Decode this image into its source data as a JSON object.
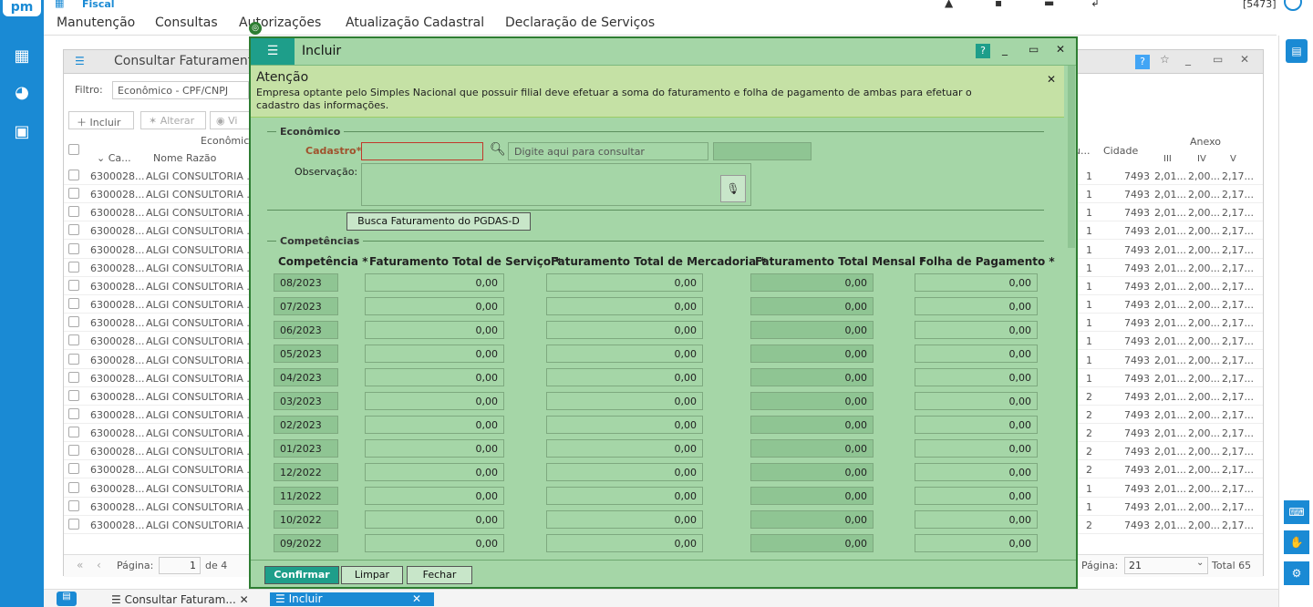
{
  "app": {
    "logo": "pm",
    "module": "Fiscal",
    "user_code": "[5473]"
  },
  "menu": [
    "Manutenção",
    "Consultas",
    "Autorizações",
    "Atualização Cadastral",
    "Declaração de Serviços"
  ],
  "bg": {
    "title": "Consultar Faturamento",
    "filter_label": "Filtro:",
    "filter_value": "Econômico - CPF/CNPJ",
    "btn_include": "Incluir",
    "btn_alter": "Alterar",
    "btn_view": "Vi",
    "group_header": "Econômico",
    "col_ca": "Ca...",
    "col_name": "Nome Razão",
    "col_cidade": "Cidade",
    "col_anexo": "Anexo",
    "col_iii": "III",
    "col_iv": "IV",
    "col_v": "V",
    "col_u": "u...",
    "row_code": "6300028...",
    "row_name": "ALGI CONSULTORIA ...",
    "row_city": "7493",
    "row_c1": "2,01...",
    "row_c2": "2,00...",
    "row_c3": "2,17...",
    "row_flags": [
      "1",
      "1",
      "1",
      "1",
      "1",
      "1",
      "1",
      "1",
      "1",
      "1",
      "1",
      "1",
      "2",
      "2",
      "2",
      "2",
      "2",
      "1",
      "1",
      "2"
    ],
    "pag_label": "Página:",
    "pag_value": "1",
    "pag_of": "de 4",
    "pag_right_label": "Página:",
    "pag_right_value": "21",
    "total": "Total 65"
  },
  "modal": {
    "title": "Incluir",
    "alert_title": "Atenção",
    "alert_text": "Empresa optante pelo Simples Nacional que possuir filial deve efetuar a soma do faturamento e folha de pagamento de ambas para efetuar o cadastro das informações.",
    "sec_economico": "Econômico",
    "cadastro_label": "Cadastro*",
    "cadastro_placeholder": "Digite aqui para consultar",
    "obs_label": "Observação:",
    "busca_btn": "Busca Faturamento do PGDAS-D",
    "sec_competencias": "Competências",
    "headers": [
      "Competência *",
      "Faturamento Total de Serviço *",
      "Faturamento Total de Mercadoria *",
      "Faturamento Total Mensal *",
      "Folha de Pagamento *"
    ],
    "rows": [
      {
        "comp": "08/2023",
        "v": "0,00"
      },
      {
        "comp": "07/2023",
        "v": "0,00"
      },
      {
        "comp": "06/2023",
        "v": "0,00"
      },
      {
        "comp": "05/2023",
        "v": "0,00"
      },
      {
        "comp": "04/2023",
        "v": "0,00"
      },
      {
        "comp": "03/2023",
        "v": "0,00"
      },
      {
        "comp": "02/2023",
        "v": "0,00"
      },
      {
        "comp": "01/2023",
        "v": "0,00"
      },
      {
        "comp": "12/2022",
        "v": "0,00"
      },
      {
        "comp": "11/2022",
        "v": "0,00"
      },
      {
        "comp": "10/2022",
        "v": "0,00"
      },
      {
        "comp": "09/2022",
        "v": "0,00"
      }
    ],
    "btn_confirm": "Confirmar",
    "btn_clear": "Limpar",
    "btn_close": "Fechar"
  },
  "tabs": {
    "tab1": "Consultar Faturam...",
    "tab2": "Incluir"
  }
}
